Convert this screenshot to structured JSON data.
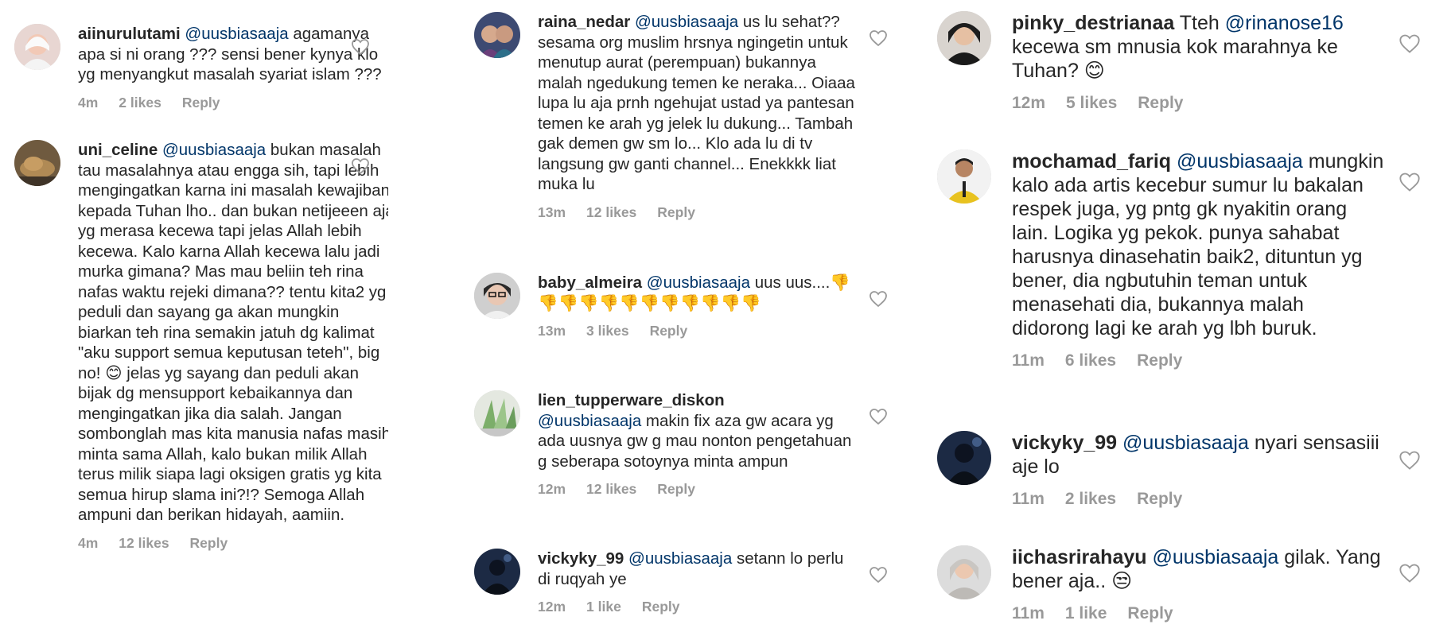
{
  "columns": [
    {
      "comments": [
        {
          "username": "aiinurulutami",
          "mention": "@uusbiasaaja",
          "text": " agamanya apa si ni orang ??? sensi bener kynya klo yg menyangkut masalah syariat islam ???",
          "time": "4m",
          "likes": "2 likes",
          "reply": "Reply"
        },
        {
          "username": "uni_celine",
          "mention": "@uusbiasaaja",
          "text": " bukan masalah tau masalahnya atau engga sih, tapi lebih mengingatkan karna ini masalah kewajiban kepada Tuhan lho.. dan bukan netijeeen aja yg merasa kecewa tapi jelas Allah lebih kecewa. Kalo karna Allah kecewa lalu jadi murka gimana? Mas mau beliin teh rina nafas waktu rejeki dimana?? tentu kita2 yg peduli dan sayang ga akan mungkin biarkan teh rina semakin jatuh dg kalimat \"aku support semua keputusan teteh\", big no! 😊 jelas yg sayang dan peduli akan bijak dg mensupport kebaikannya dan mengingatkan jika dia salah. Jangan sombonglah mas kita manusia nafas masih minta sama Allah, kalo bukan milik Allah terus milik siapa lagi oksigen gratis yg kita semua hirup slama ini?!? Semoga Allah ampuni dan berikan hidayah, aamiin.",
          "time": "4m",
          "likes": "12 likes",
          "reply": "Reply"
        }
      ]
    },
    {
      "comments": [
        {
          "username": "raina_nedar",
          "mention": "@uusbiasaaja",
          "text": " us lu sehat??sesama org muslim hrsnya ngingetin untuk menutup aurat (perempuan) bukannya malah ngedukung temen ke neraka... Oiaaa lupa lu aja prnh ngehujat ustad ya pantesan temen ke arah yg jelek lu dukung... Tambah gak demen gw sm lo... Klo ada lu di tv langsung gw ganti channel... Enekkkk liat muka lu",
          "time": "13m",
          "likes": "12 likes",
          "reply": "Reply"
        },
        {
          "username": "baby_almeira",
          "mention": "@uusbiasaaja",
          "text": " uus uus....👎👎👎👎👎👎👎👎👎👎👎👎",
          "time": "13m",
          "likes": "3 likes",
          "reply": "Reply"
        },
        {
          "username": "lien_tupperware_diskon",
          "mention": "@uusbiasaaja",
          "text": "  makin fix aza gw acara yg ada uusnya gw g mau nonton pengetahuan g seberapa sotoynya minta ampun",
          "time": "12m",
          "likes": "12 likes",
          "reply": "Reply"
        },
        {
          "username": "vickyky_99",
          "mention": "@uusbiasaaja",
          "text": " setann lo perlu di ruqyah ye",
          "time": "12m",
          "likes": "1 like",
          "reply": "Reply"
        }
      ]
    },
    {
      "comments": [
        {
          "username": "pinky_destrianaa",
          "mention": "",
          "text": " Tteh ",
          "mention2": "@rinanose16",
          "text2": " kecewa sm mnusia kok marahnya ke Tuhan? 😊",
          "time": "12m",
          "likes": "5 likes",
          "reply": "Reply"
        },
        {
          "username": "mochamad_fariq",
          "mention": "@uusbiasaaja",
          "text": " mungkin kalo ada artis kecebur sumur lu bakalan respek juga, yg pntg gk nyakitin orang lain.  Logika yg pekok. punya sahabat harusnya dinasehatin baik2, dituntun yg bener, dia ngbutuhin teman untuk menasehati dia, bukannya malah didorong lagi ke arah yg lbh buruk.",
          "time": "11m",
          "likes": "6 likes",
          "reply": "Reply"
        },
        {
          "username": "vickyky_99",
          "mention": "@uusbiasaaja",
          "text": " nyari sensasiii aje lo",
          "time": "11m",
          "likes": "2 likes",
          "reply": "Reply"
        },
        {
          "username": "iichasrirahayu",
          "mention": "@uusbiasaaja",
          "text": " gilak. Yang bener aja.. 😒",
          "time": "11m",
          "likes": "1 like",
          "reply": "Reply"
        }
      ]
    }
  ]
}
